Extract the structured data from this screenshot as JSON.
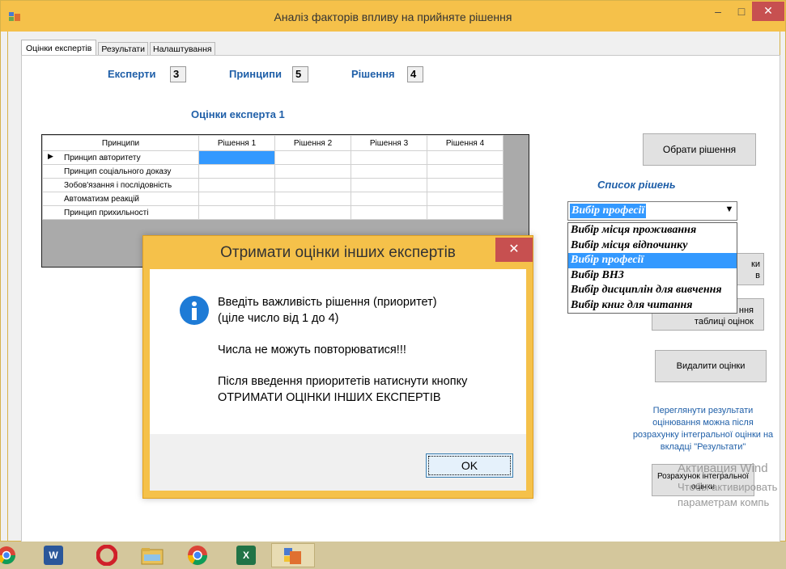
{
  "window": {
    "title": "Аналіз факторів впливу на прийняте рішення",
    "minimize": "–",
    "maximize": "□",
    "close": "✕"
  },
  "tabs": [
    {
      "label": "Оцінки експертів",
      "active": true
    },
    {
      "label": "Результати",
      "active": false
    },
    {
      "label": "Налаштування",
      "active": false
    }
  ],
  "counters": {
    "experts_label": "Експерти",
    "experts_value": "3",
    "principles_label": "Принципи",
    "principles_value": "5",
    "decisions_label": "Рішення",
    "decisions_value": "4"
  },
  "grid": {
    "title": "Оцінки експерта 1",
    "header_first": "Принципи",
    "columns": [
      "Рішення 1",
      "Рішення 2",
      "Рішення 3",
      "Рішення 4"
    ],
    "rows": [
      "Принцип авторитету",
      "Принцип соціального доказу",
      "Зобов'язання і послідовність",
      "Автоматизм реакцій",
      "Принцип прихильності"
    ],
    "current_row_marker": "▶"
  },
  "right_panel": {
    "choose_button": "Обрати рішення",
    "list_title": "Список рішень",
    "combo_value": "Вибір професії",
    "options": [
      "Вибір місця проживання",
      "Вибір  місця відпочинку",
      "Вибір професії",
      "Вибір ВНЗ",
      "Вибір дисциплін для вивчення",
      "Вибір книг для читання"
    ],
    "selected_index": 2,
    "hidden_btn1_line1": "ки",
    "hidden_btn1_line2": "в",
    "hidden_btn2_line1": "ння",
    "hidden_btn2_line2": "таблиці оцінок",
    "delete_button": "Видалити оцінки",
    "note": "Переглянути результати оцінювання можна після розрахунку інтегральної оцінки на вкладці \"Результати\"",
    "calc_button_line1": "Розрахунок інтегральної",
    "calc_button_line2": "оцінки"
  },
  "watermark": {
    "line1": "Активация Wind",
    "line2": "Чтобы активировать",
    "line3": "параметрам компь"
  },
  "dialog": {
    "title": "Отримати оцінки інших експертів",
    "close": "✕",
    "line1": "Введіть важливість рішення (приоритет)",
    "line2": "(ціле число від 1 до 4)",
    "line3": "Числа не можуть повторюватися!!!",
    "line4": "Після введення приоритетів натиснути кнопку",
    "line5": "ОТРИМАТИ ОЦІНКИ ІНШИХ ЕКСПЕРТІВ",
    "ok": "OK",
    "icon": "info-icon"
  },
  "taskbar": {
    "items": [
      "chrome-partial",
      "word",
      "opera",
      "file-explorer",
      "chrome",
      "excel",
      "app"
    ],
    "word_glyph": "W",
    "excel_glyph": "X"
  },
  "colors": {
    "titlebar": "#f5c14a",
    "accent_text": "#1f5fa8",
    "selection": "#3399ff",
    "close_red": "#c75050"
  }
}
